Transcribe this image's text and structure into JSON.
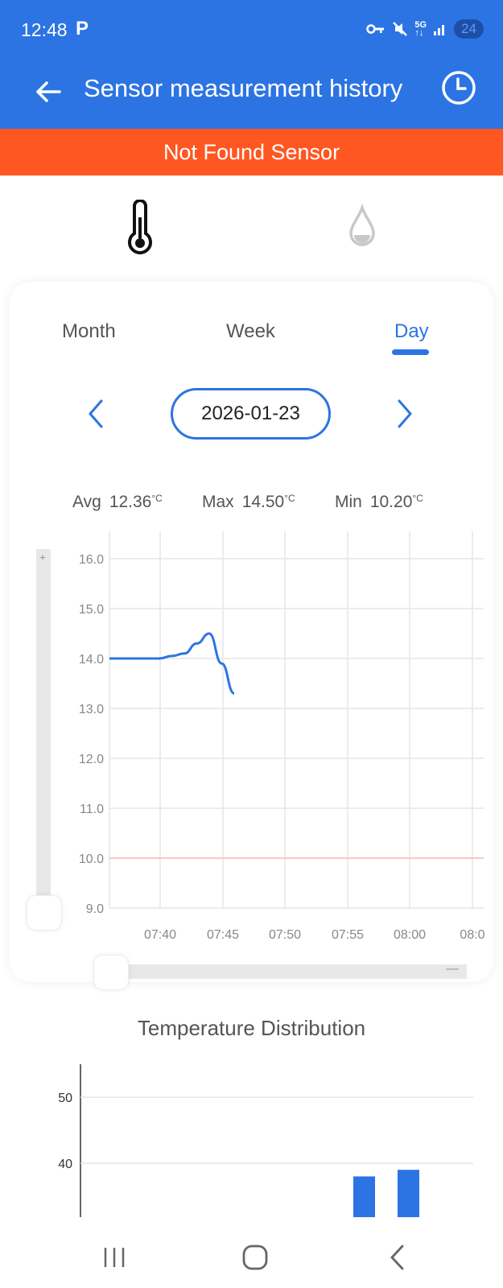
{
  "status_bar": {
    "time": "12:48",
    "battery": "24"
  },
  "app_bar": {
    "title": "Sensor measurement history"
  },
  "banner": {
    "text": "Not Found Sensor"
  },
  "period_tabs": [
    "Month",
    "Week",
    "Day"
  ],
  "selected_period": "Day",
  "date": "2026-01-23",
  "stats": {
    "avg_label": "Avg",
    "avg_value": "12.36",
    "avg_unit": "°C",
    "max_label": "Max",
    "max_value": "14.50",
    "max_unit": "°C",
    "min_label": "Min",
    "min_value": "10.20",
    "min_unit": "°C"
  },
  "icons": {
    "status": [
      "p-icon",
      "vpn-key-icon",
      "mute-icon",
      "5g-icon",
      "signal-icon",
      "battery-icon"
    ],
    "app_bar": [
      "back-arrow-icon",
      "history-clock-icon"
    ],
    "sensor_tabs": [
      "thermometer-icon",
      "humidity-drop-icon"
    ],
    "date_nav": [
      "chevron-left-icon",
      "chevron-right-icon"
    ],
    "nav_bar": [
      "recent-apps-icon",
      "home-icon",
      "back-icon"
    ]
  },
  "colors": {
    "primary": "#2c74e3",
    "banner": "#ff5722",
    "line": "#2c74e3",
    "min_line": "#f8c8c0"
  },
  "chart_data": [
    {
      "type": "line",
      "y_ticks": [
        "16.0",
        "15.0",
        "14.0",
        "13.0",
        "12.0",
        "11.0",
        "10.0",
        "9.0"
      ],
      "x_ticks": [
        "07:40",
        "07:45",
        "07:50",
        "07:55",
        "08:00",
        "08:0"
      ],
      "ylim": [
        9.0,
        16.0
      ],
      "xlim": [
        "07:36",
        "08:05"
      ],
      "series": [
        {
          "x": [
            "07:36",
            "07:40",
            "07:41",
            "07:42",
            "07:43",
            "07:44",
            "07:45",
            "07:46"
          ],
          "y": [
            14.0,
            14.0,
            14.05,
            14.1,
            14.3,
            14.5,
            13.9,
            13.3
          ]
        }
      ],
      "threshold_line": 10.0,
      "grid": true
    },
    {
      "type": "bar",
      "title": "Temperature Distribution",
      "y_ticks": [
        "50",
        "40"
      ],
      "values_visible": [
        38,
        39
      ],
      "grid": true
    }
  ]
}
